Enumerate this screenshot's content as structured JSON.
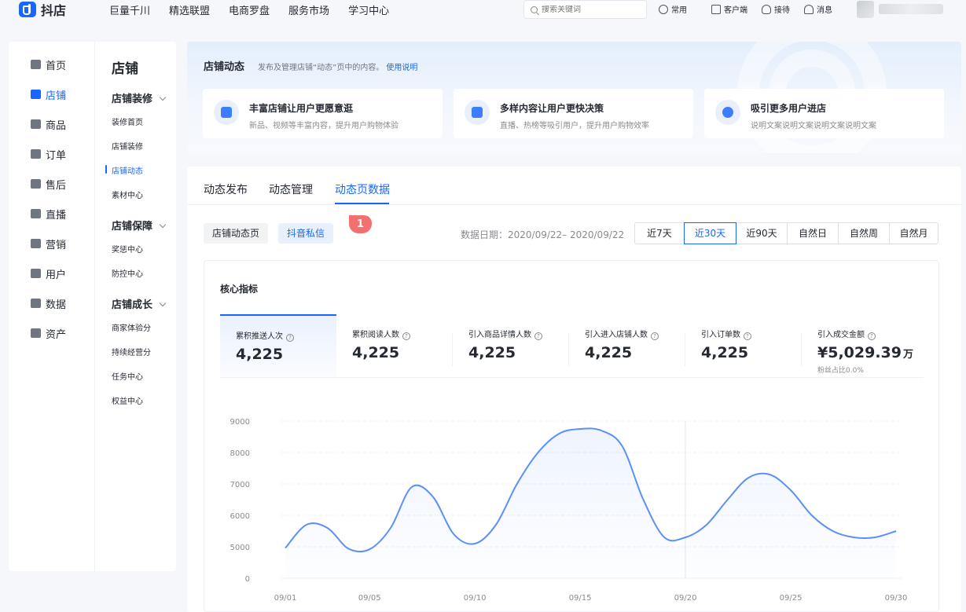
{
  "header": {
    "logo_text": "抖店",
    "nav": [
      "巨量千川",
      "精选联盟",
      "电商罗盘",
      "服务市场",
      "学习中心"
    ],
    "search_placeholder": "搜索关键词",
    "tools": [
      {
        "label": "常用",
        "icon": "clock-icon"
      },
      {
        "label": "客户端",
        "icon": "download-icon"
      },
      {
        "label": "接待",
        "icon": "headset-icon"
      },
      {
        "label": "消息",
        "icon": "bell-icon"
      }
    ]
  },
  "sidebar": {
    "items": [
      {
        "label": "首页",
        "icon": "home-icon",
        "active": false
      },
      {
        "label": "店铺",
        "icon": "store-icon",
        "active": true
      },
      {
        "label": "商品",
        "icon": "product-icon",
        "active": false
      },
      {
        "label": "订单",
        "icon": "order-icon",
        "active": false
      },
      {
        "label": "售后",
        "icon": "aftersale-icon",
        "active": false
      },
      {
        "label": "直播",
        "icon": "live-icon",
        "active": false
      },
      {
        "label": "营销",
        "icon": "marketing-icon",
        "active": false
      },
      {
        "label": "用户",
        "icon": "user-icon",
        "active": false
      },
      {
        "label": "数据",
        "icon": "data-icon",
        "active": false
      },
      {
        "label": "资产",
        "icon": "asset-icon",
        "active": false
      }
    ],
    "section_title": "店铺",
    "groups": [
      {
        "title": "店铺装修",
        "items": [
          "装修首页",
          "店铺装修",
          "店铺动态",
          "素材中心"
        ]
      },
      {
        "title": "店铺保障",
        "items": [
          "奖惩中心",
          "防控中心"
        ]
      },
      {
        "title": "店铺成长",
        "items": [
          "商家体验分",
          "持续经营分",
          "任务中心",
          "权益中心"
        ]
      }
    ],
    "active_sub": "店铺动态"
  },
  "intro": {
    "title": "店铺动态",
    "desc": "发布及管理店铺“动态”页中的内容。",
    "link": "使用说明",
    "features": [
      {
        "title": "丰富店铺让用户更愿意逛",
        "desc": "新品、视频等丰富内容，提升用户购物体验",
        "icon": "smile-icon"
      },
      {
        "title": "多样内容让用户更快决策",
        "desc": "直播、热榜等吸引用户，提升用户购物效率",
        "icon": "trend-icon"
      },
      {
        "title": "吸引更多用户进店",
        "desc": "说明文案说明文案说明文案说明文案",
        "icon": "person-icon"
      }
    ]
  },
  "main": {
    "tabs": [
      "动态发布",
      "动态管理",
      "动态页数据"
    ],
    "active_tab": 2,
    "sub_tabs": [
      "店铺动态页",
      "抖音私信"
    ],
    "active_sub_tab": 1,
    "badge": "1",
    "date_range": "数据日期：2020/09/22– 2020/09/22",
    "ranges": [
      "近7天",
      "近30天",
      "近90天",
      "自然日",
      "自然周",
      "自然月"
    ],
    "active_range": 1,
    "panel_title": "核心指标",
    "metrics": [
      {
        "label": "累积推送人次",
        "value": "4,225"
      },
      {
        "label": "累积阅读人数",
        "value": "4,225"
      },
      {
        "label": "引入商品详情人数",
        "value": "4,225"
      },
      {
        "label": "引入进入店铺人数",
        "value": "4,225"
      },
      {
        "label": "引入订单数",
        "value": "4,225"
      },
      {
        "label": "引入成交金额",
        "value": "¥5,029.39",
        "unit": "万",
        "note": "粉丝占比0.0%"
      }
    ],
    "help_glyph": "?"
  },
  "colors": {
    "accent": "#1966ff",
    "badge": "#f2706d",
    "line": "#5b8ff9"
  },
  "chart_data": {
    "type": "area",
    "x": [
      "09/01",
      "09/02",
      "09/03",
      "09/04",
      "09/05",
      "09/06",
      "09/07",
      "09/08",
      "09/09",
      "09/10",
      "09/11",
      "09/12",
      "09/13",
      "09/14",
      "09/15",
      "09/16",
      "09/17",
      "09/18",
      "09/19",
      "09/20",
      "09/21",
      "09/22",
      "09/23",
      "09/24",
      "09/25",
      "09/26",
      "09/27",
      "09/28",
      "09/29",
      "09/30"
    ],
    "tick_labels": [
      "09/01",
      "09/05",
      "09/10",
      "09/15",
      "09/20",
      "09/25",
      "09/30"
    ],
    "series": [
      {
        "values": [
          4800,
          5700,
          5600,
          4700,
          4600,
          5600,
          6900,
          6600,
          5400,
          5100,
          5700,
          7000,
          8000,
          8600,
          8750,
          8700,
          8200,
          6500,
          5300,
          5300,
          5700,
          6500,
          7200,
          7300,
          6800,
          6000,
          5500,
          5300,
          5300,
          5500
        ]
      }
    ],
    "yticks": [
      0,
      5000,
      6000,
      7000,
      8000,
      9000
    ],
    "ylim": [
      4000,
      9000
    ],
    "grid": true
  }
}
